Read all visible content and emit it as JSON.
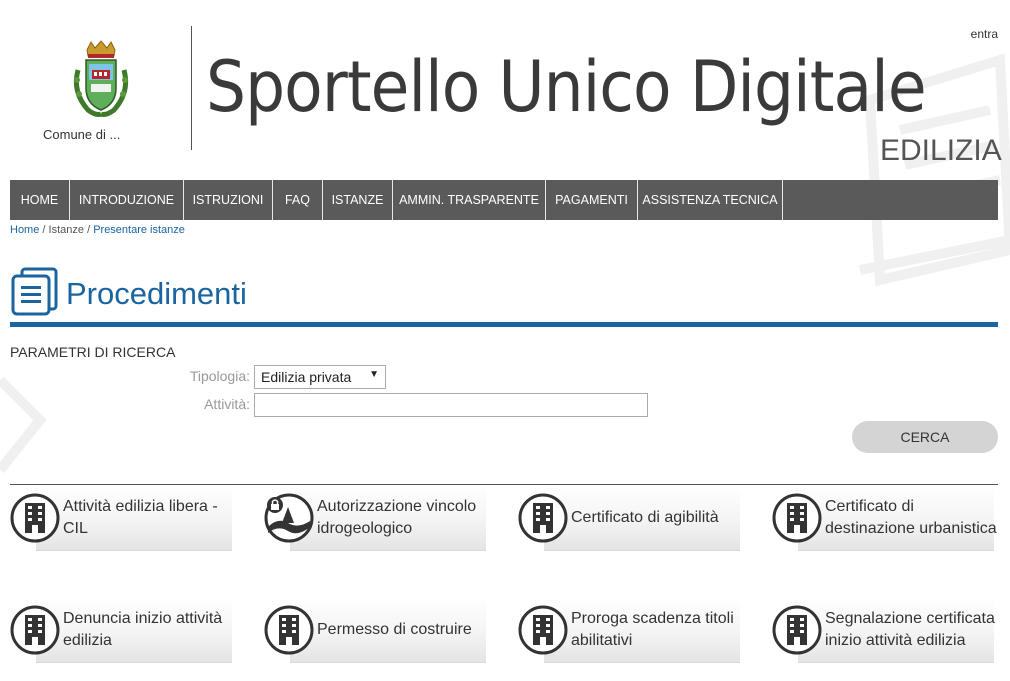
{
  "header": {
    "login_label": "entra",
    "comune_label": "Comune di ...",
    "site_title": "Sportello Unico Digitale",
    "site_subtitle": "EDILIZIA",
    "crest_icon": "municipal-crest-icon"
  },
  "nav": {
    "items": [
      {
        "label": "HOME"
      },
      {
        "label": "INTRODUZIONE"
      },
      {
        "label": "ISTRUZIONI"
      },
      {
        "label": "FAQ"
      },
      {
        "label": "ISTANZE"
      },
      {
        "label": "AMMIN. TRASPARENTE"
      },
      {
        "label": "PAGAMENTI"
      },
      {
        "label": "ASSISTENZA TECNICA"
      }
    ]
  },
  "breadcrumb": {
    "items": [
      "Home",
      "Istanze",
      "Presentare istanze"
    ],
    "separator": "/"
  },
  "page": {
    "title": "Procedimenti",
    "icon": "documents-icon"
  },
  "search": {
    "section_title": "PARAMETRI DI RICERCA",
    "tipologia_label": "Tipologia:",
    "tipologia_value": "Edilizia privata",
    "attivita_label": "Attività:",
    "attivita_value": "",
    "submit_label": "CERCA"
  },
  "procedures": {
    "items": [
      {
        "label": "Attività edilizia libera - CIL",
        "icon": "building-icon"
      },
      {
        "label": "Autorizzazione vincolo idrogeologico",
        "icon": "landscape-lock-icon"
      },
      {
        "label": "Certificato di agibilità",
        "icon": "building-icon"
      },
      {
        "label": "Certificato di destinazione urbanistica",
        "icon": "building-icon"
      },
      {
        "label": "Denuncia inizio attività edilizia",
        "icon": "building-icon"
      },
      {
        "label": "Permesso di costruire",
        "icon": "building-icon"
      },
      {
        "label": "Proroga scadenza titoli abilitativi",
        "icon": "building-icon"
      },
      {
        "label": "Segnalazione certificata inizio attività edilizia",
        "icon": "building-icon"
      }
    ]
  },
  "colors": {
    "accent": "#1a64a0",
    "nav_bg": "#5a5a5a",
    "button_bg": "#d4d4d4"
  }
}
